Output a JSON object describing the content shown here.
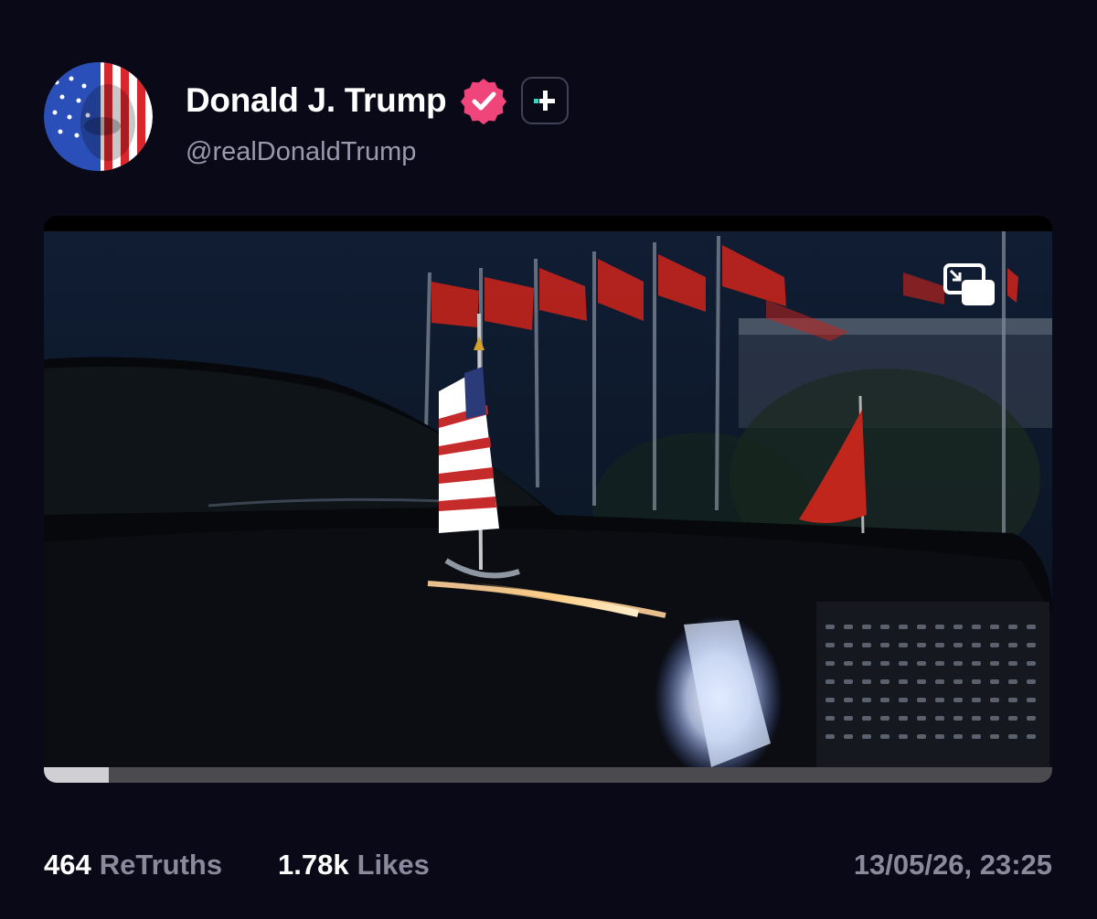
{
  "author": {
    "display_name": "Donald J. Trump",
    "handle": "@realDonaldTrump",
    "verified_icon": "verified-badge-icon",
    "follow_icon": "plus-icon"
  },
  "media": {
    "type": "video",
    "pip_icon": "picture-in-picture-icon",
    "progress": 0.064
  },
  "stats": {
    "retruths_count": "464",
    "retruths_label": "ReTruths",
    "likes_count": "1.78k",
    "likes_label": "Likes",
    "timestamp": "13/05/26, 23:25"
  },
  "colors": {
    "background": "#0a0918",
    "verified_badge": "#f0457a",
    "follow_accent": "#3ed6c3",
    "muted_text": "#8a8a9c"
  }
}
